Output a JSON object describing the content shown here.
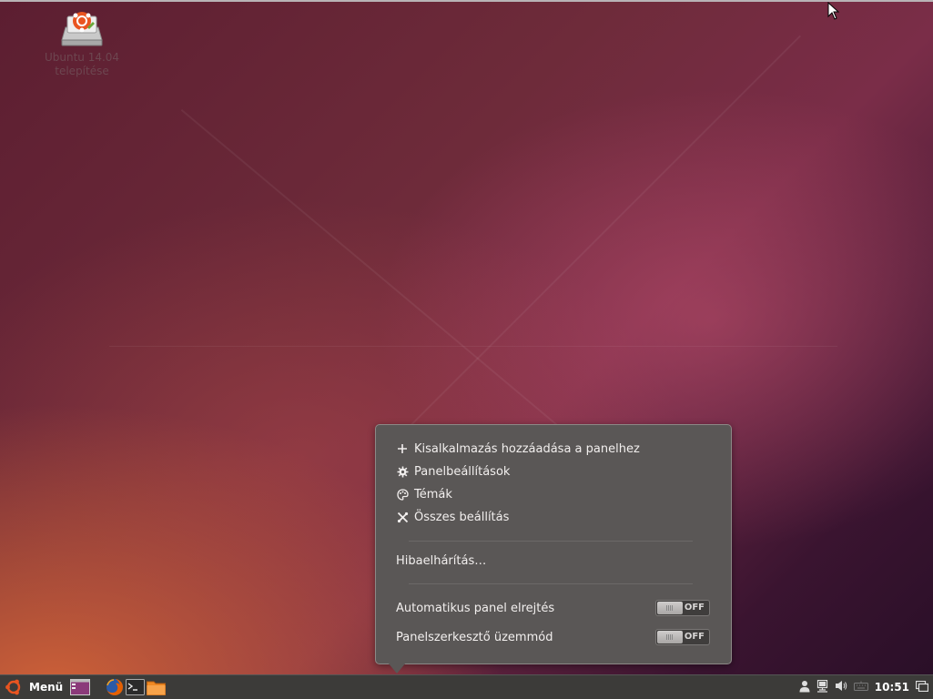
{
  "desktop": {
    "icon": {
      "name": "ubuntu-installer-icon",
      "label_line1": "Ubuntu 14.04",
      "label_line2": "telepítése"
    }
  },
  "popup": {
    "items": [
      {
        "icon": "plus-icon",
        "label": "Kisalkalmazás hozzáadása a panelhez"
      },
      {
        "icon": "gear-icon",
        "label": "Panelbeállítások"
      },
      {
        "icon": "palette-icon",
        "label": "Témák"
      },
      {
        "icon": "tools-icon",
        "label": "Összes beállítás"
      }
    ],
    "troubleshoot_label": "Hibaelhárítás…",
    "toggles": [
      {
        "label": "Automatikus panel elrejtés",
        "state": "OFF"
      },
      {
        "label": "Panelszerkesztő üzemmód",
        "state": "OFF"
      }
    ]
  },
  "taskbar": {
    "menu_label": "Menü",
    "launchers": [
      "show-desktop-icon",
      "firefox-icon",
      "terminal-icon",
      "files-icon"
    ],
    "tray_icons": [
      "user-icon",
      "network-icon",
      "volume-icon",
      "keyboard-icon"
    ],
    "clock": "10:51",
    "window_list_icon": "window-list-icon"
  },
  "colors": {
    "panel_bg": "#3c3b39",
    "popup_bg": "#5a5756",
    "ubuntu_orange": "#e95420"
  }
}
